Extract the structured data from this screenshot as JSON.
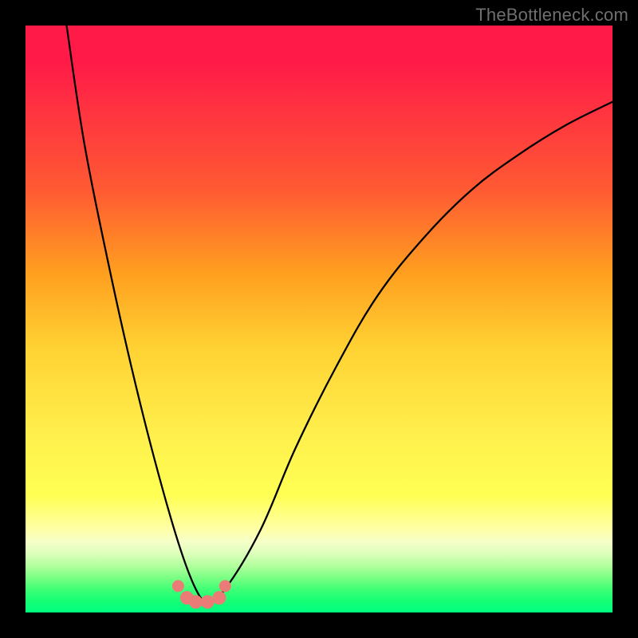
{
  "watermark": "TheBottleneck.com",
  "chart_data": {
    "type": "line",
    "title": "",
    "xlabel": "",
    "ylabel": "",
    "xlim": [
      0,
      100
    ],
    "ylim": [
      0,
      100
    ],
    "series": [
      {
        "name": "curve",
        "x": [
          7.0,
          10.0,
          14.0,
          18.0,
          22.0,
          26.0,
          29.0,
          31.0,
          34.0,
          40.0,
          46.0,
          53.0,
          60.0,
          68.0,
          76.0,
          84.0,
          92.0,
          100.0
        ],
        "values": [
          100.0,
          80.0,
          60.0,
          42.0,
          26.0,
          12.0,
          4.0,
          2.0,
          4.0,
          14.0,
          28.0,
          42.0,
          54.0,
          64.0,
          72.0,
          78.0,
          83.0,
          87.0
        ]
      },
      {
        "name": "markers",
        "x": [
          26.0,
          27.5,
          29.0,
          31.0,
          33.0,
          34.0
        ],
        "values": [
          4.5,
          2.5,
          1.8,
          1.8,
          2.5,
          4.5
        ]
      }
    ],
    "colors": {
      "curve": "#000000",
      "markers": "#eb7b77"
    }
  }
}
